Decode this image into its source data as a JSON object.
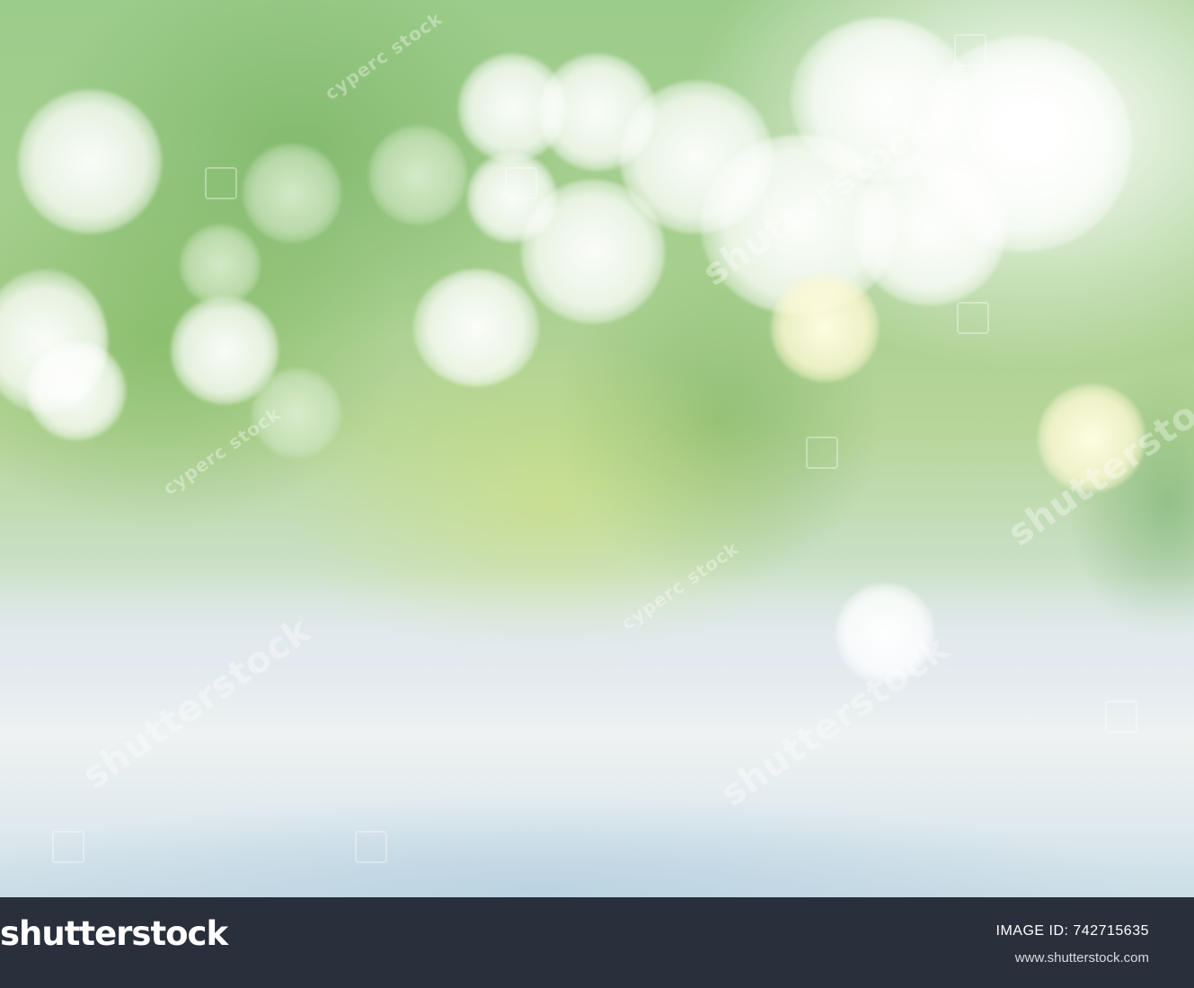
{
  "footer": {
    "logo_text": "shutterstock",
    "image_id_label": "IMAGE ID:",
    "image_id": "742715635",
    "site": "www.shutterstock.com",
    "background_color": "#29303b"
  },
  "watermarks": [
    "shutterstock",
    "cyperc stock"
  ]
}
